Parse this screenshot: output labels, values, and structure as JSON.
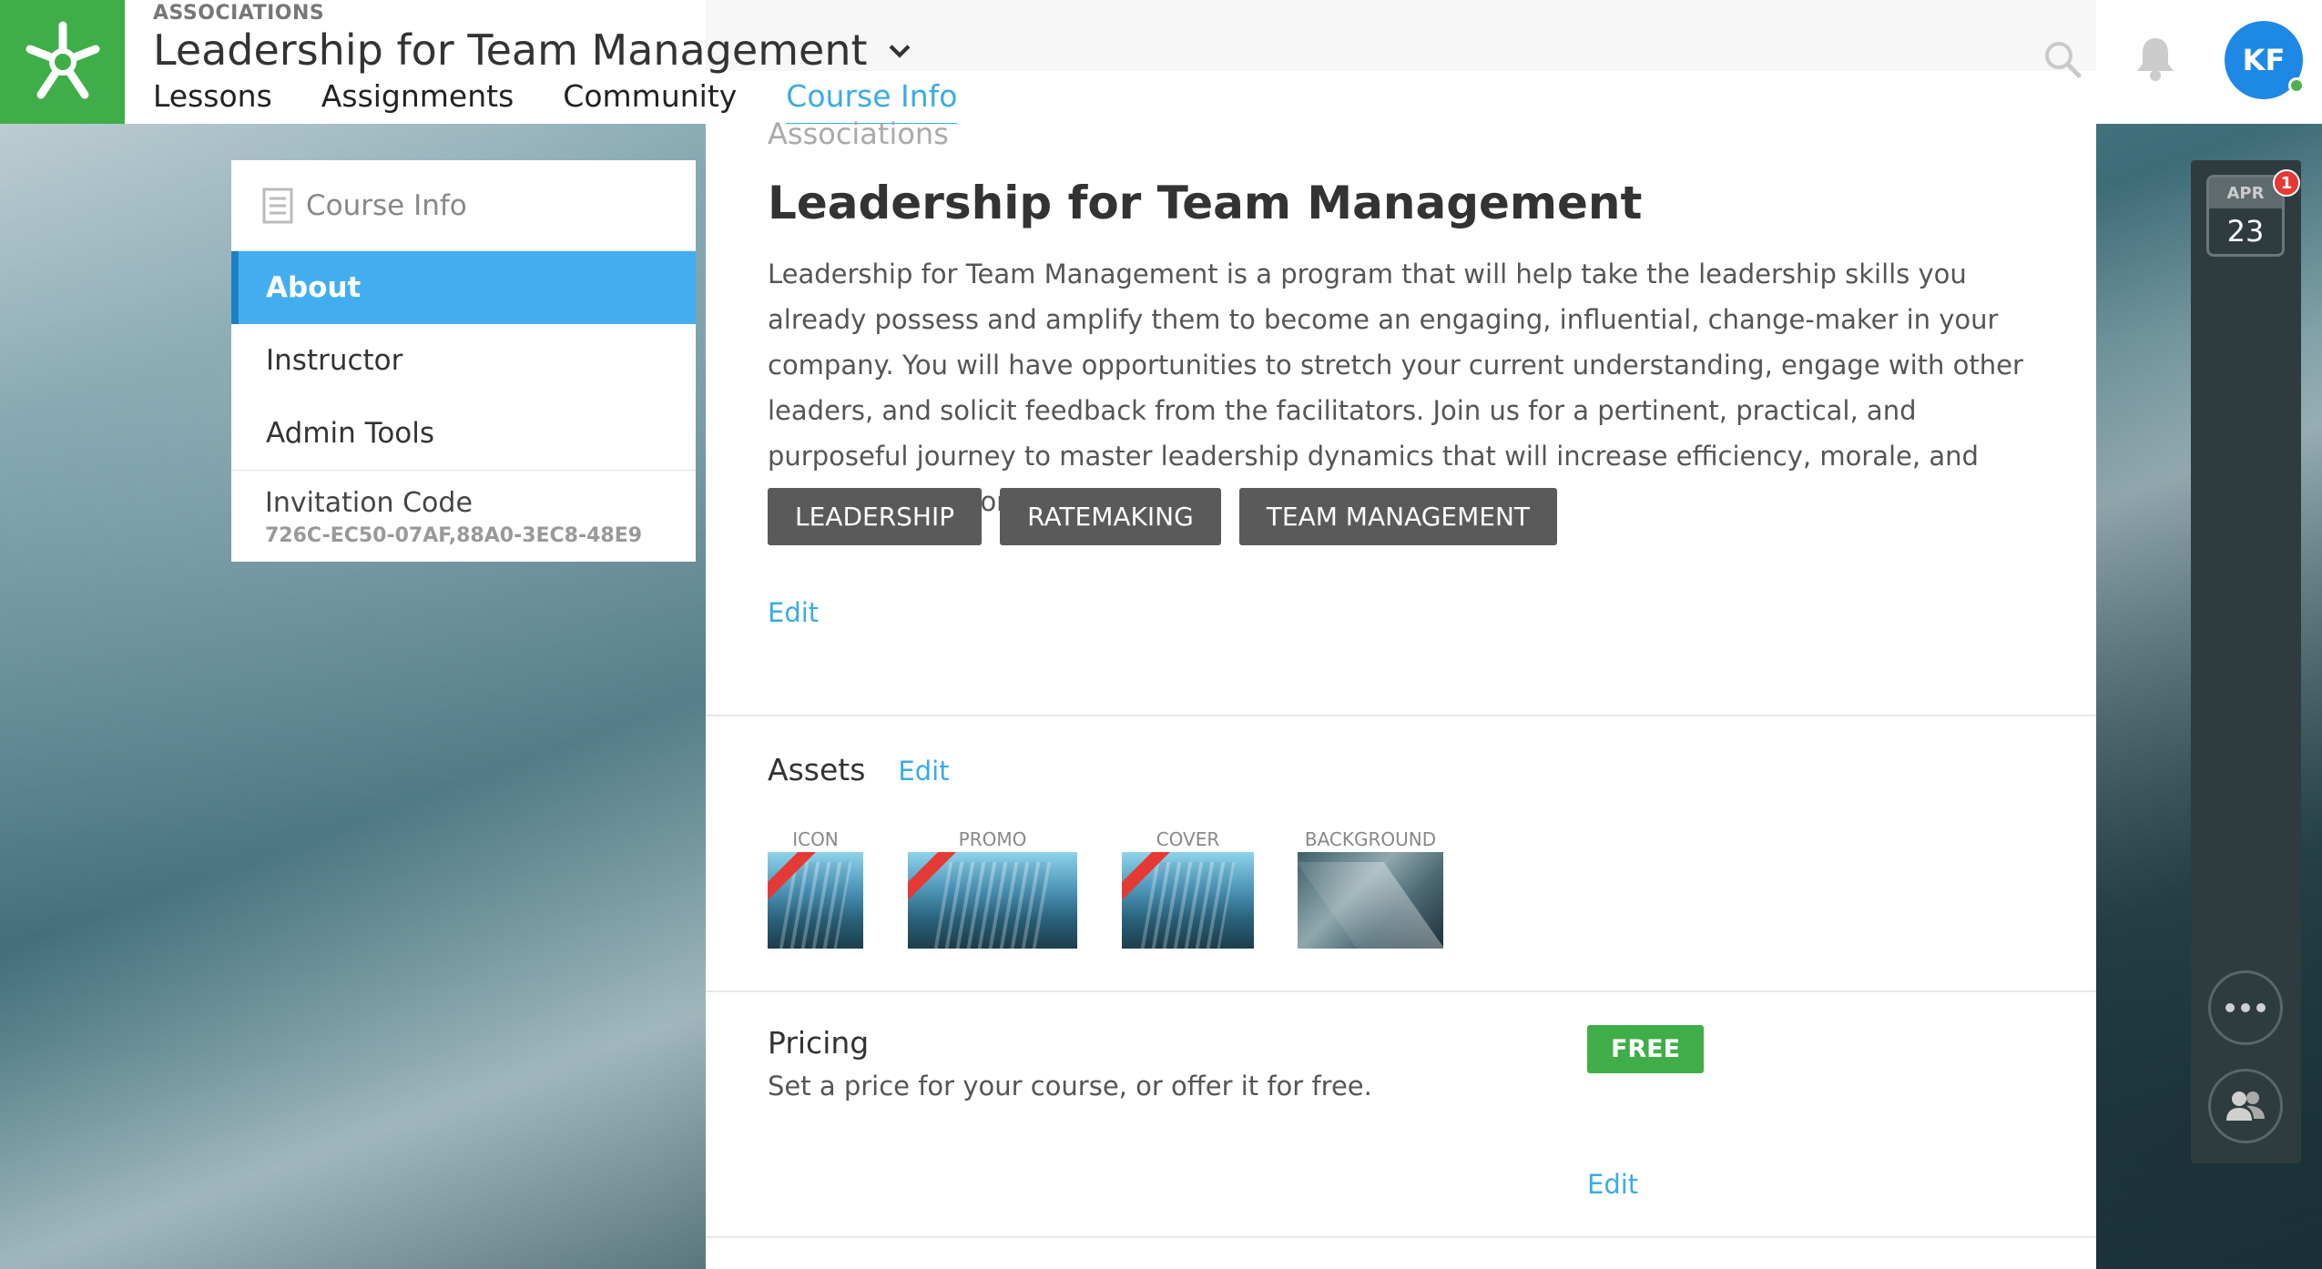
{
  "header": {
    "breadcrumb": "ASSOCIATIONS",
    "course_title": "Leadership for Team Management",
    "tabs": [
      {
        "label": "Lessons"
      },
      {
        "label": "Assignments"
      },
      {
        "label": "Community"
      },
      {
        "label": "Course Info"
      }
    ],
    "active_tab": "Course Info",
    "avatar_initials": "KF"
  },
  "sidebar": {
    "heading": "Course Info",
    "items": [
      {
        "label": "About"
      },
      {
        "label": "Instructor"
      },
      {
        "label": "Admin Tools"
      }
    ],
    "active_item": "About",
    "invitation_label": "Invitation Code",
    "invitation_code": "726C-EC50-07AF,88A0-3EC8-48E9"
  },
  "about": {
    "cut_heading": "Associations",
    "title": "Leadership for Team Management",
    "description": "Leadership for Team Management is a program that will help take the leadership skills you already possess and amplify them to become an engaging, influential, change-maker in your company. You will have opportunities to stretch your current understanding, engage with other leaders, and solicit feedback from the facilitators. Join us for a pertinent, practical, and purposeful journey to master leadership dynamics that will increase efficiency, morale, and positive culture on your team.",
    "tags": [
      "LEADERSHIP",
      "RATEMAKING",
      "TEAM MANAGEMENT"
    ],
    "edit_label": "Edit"
  },
  "assets": {
    "title": "Assets",
    "edit_label": "Edit",
    "items": [
      {
        "caption": "ICON"
      },
      {
        "caption": "PROMO"
      },
      {
        "caption": "COVER"
      },
      {
        "caption": "BACKGROUND"
      }
    ]
  },
  "pricing": {
    "title": "Pricing",
    "subtitle": "Set a price for your course, or offer it for free.",
    "badge": "FREE",
    "edit_label": "Edit"
  },
  "rail": {
    "calendar_month": "APR",
    "calendar_day": "23",
    "calendar_badge": "1"
  },
  "colors": {
    "brand_green": "#3fae49",
    "accent_blue": "#3aabe6",
    "active_item_bg": "#42aef0",
    "tag_bg": "#5a5a5a",
    "rail_bg": "#2e3c40"
  },
  "icons": [
    "logo-star-icon",
    "chevron-down-icon",
    "search-icon",
    "bell-icon",
    "document-icon",
    "more-dots-icon",
    "people-icon"
  ]
}
